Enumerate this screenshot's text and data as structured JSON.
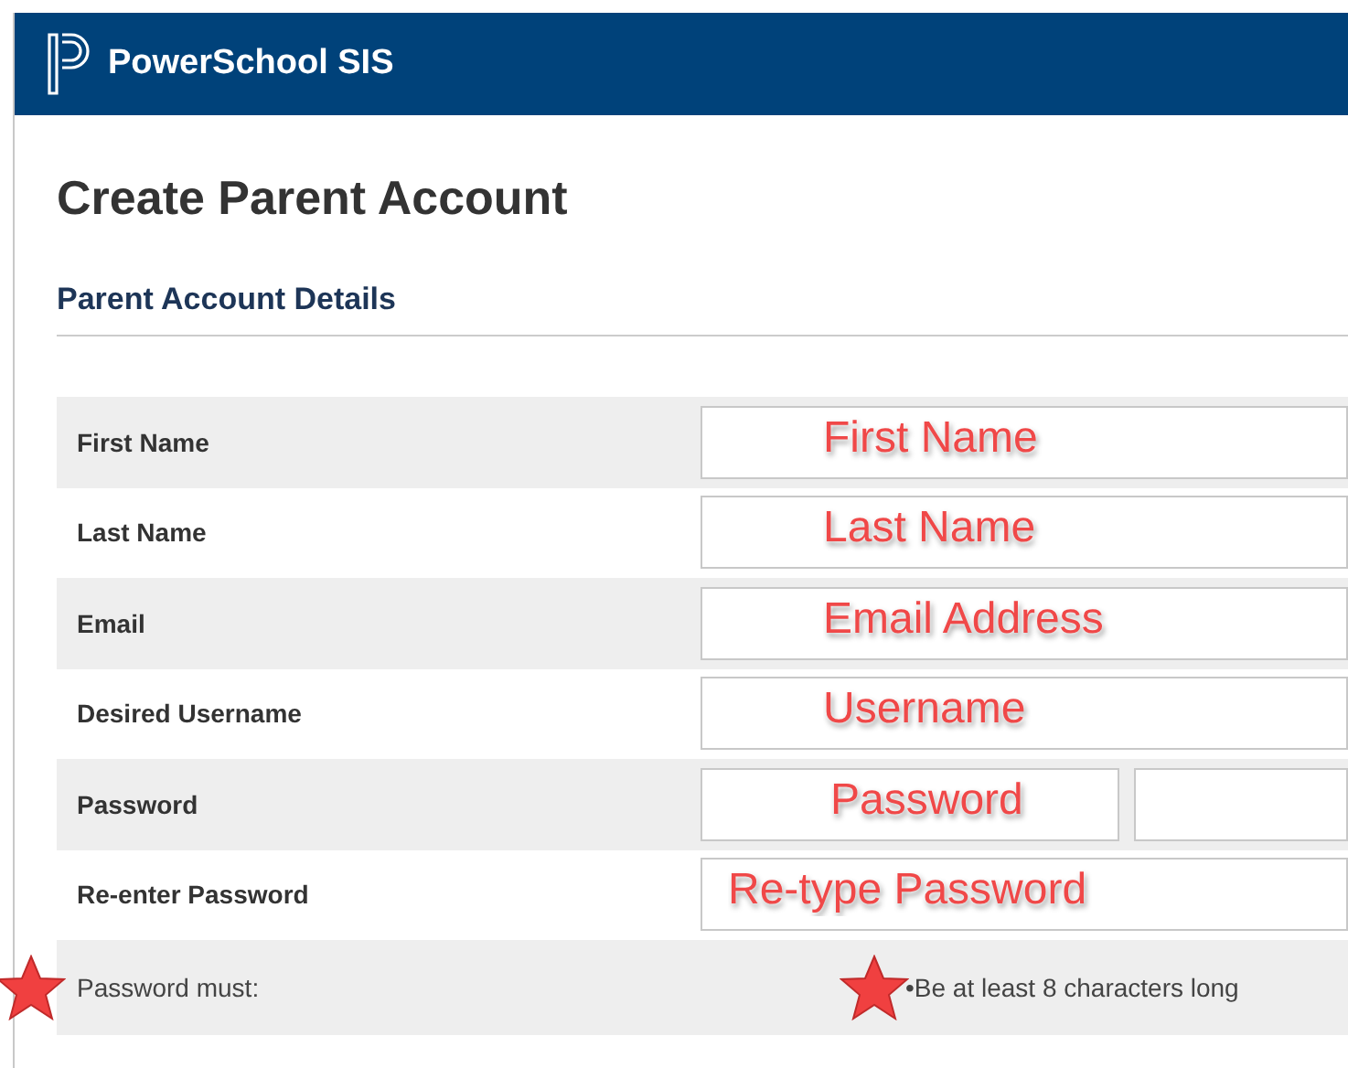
{
  "header": {
    "title": "PowerSchool SIS"
  },
  "page_title": "Create Parent Account",
  "section_title": "Parent Account Details",
  "fields": [
    {
      "label": "First Name",
      "kind": "single",
      "value": "First Name"
    },
    {
      "label": "Last Name",
      "kind": "single",
      "value": "Last Name"
    },
    {
      "label": "Email",
      "kind": "single",
      "value": "Email Address"
    },
    {
      "label": "Desired Username",
      "kind": "single",
      "value": "Username"
    },
    {
      "label": "Password",
      "kind": "split",
      "value": "Password"
    },
    {
      "label": "Re-enter Password",
      "kind": "single",
      "value": "Re-type Password"
    }
  ],
  "requirements": {
    "label": "Password must:",
    "rule": "•Be at least 8 characters long"
  }
}
